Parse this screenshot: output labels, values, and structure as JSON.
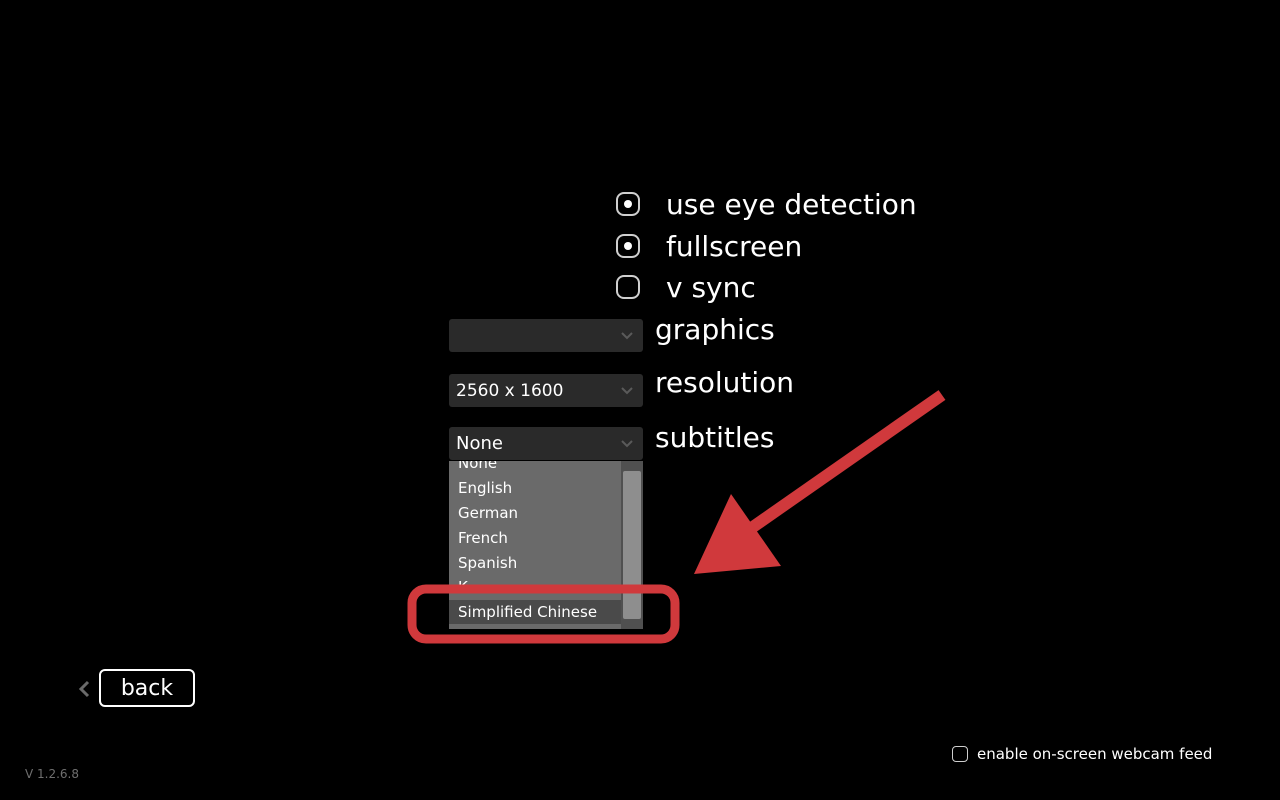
{
  "options": [
    {
      "label": "use eye detection",
      "checked": true
    },
    {
      "label": "fullscreen",
      "checked": true
    },
    {
      "label": "v sync",
      "checked": false
    }
  ],
  "graphics": {
    "label": "graphics",
    "value": ""
  },
  "resolution": {
    "label": "resolution",
    "value": "2560 x 1600"
  },
  "subtitles": {
    "label": "subtitles",
    "value": "None",
    "list_items": [
      "None",
      "English",
      "German",
      "French",
      "Spanish",
      "K",
      "Simplified Chinese"
    ],
    "highlighted_item": "Simplified Chinese"
  },
  "back_label": "back",
  "webcam": {
    "label": "enable on-screen webcam feed",
    "checked": false
  },
  "version": "V 1.2.6.8",
  "annotation": {
    "color": "#d0393c"
  },
  "icons": {
    "caret": "chevron-down-icon",
    "back": "chevron-left-icon",
    "check": "dot-icon"
  }
}
